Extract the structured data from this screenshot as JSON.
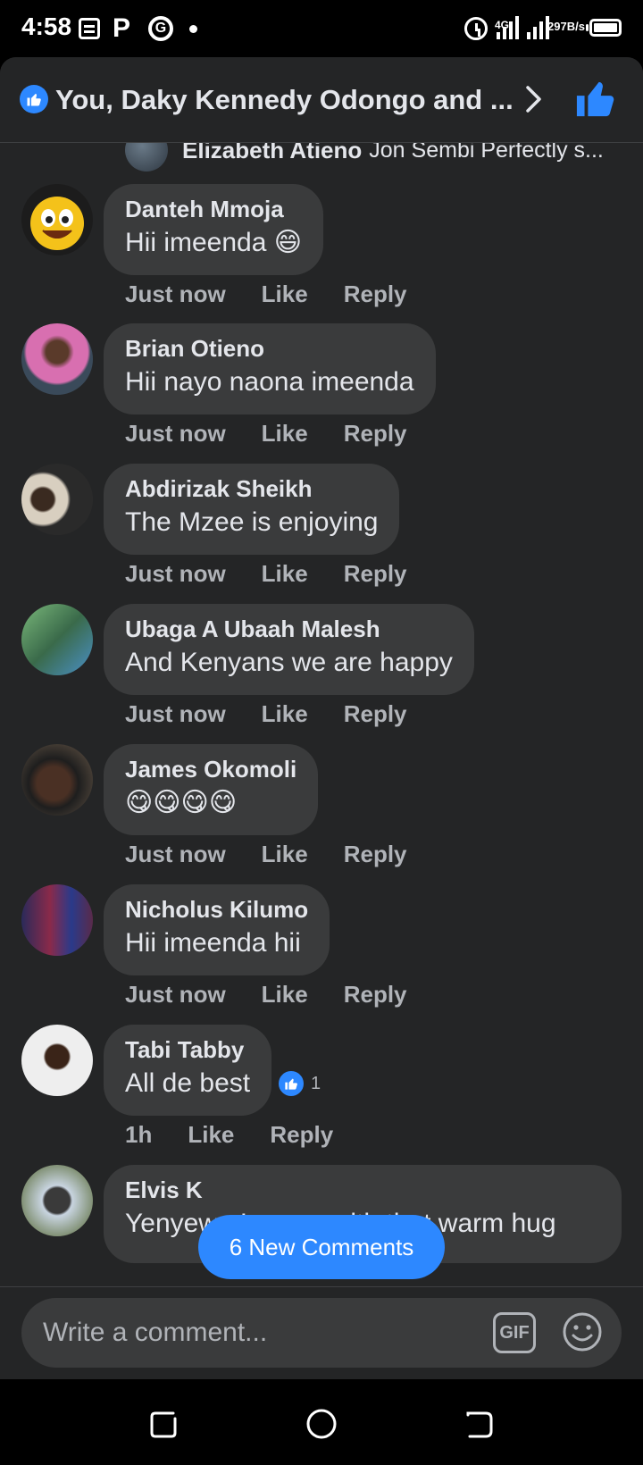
{
  "status_bar": {
    "time": "4:58",
    "network": "4G",
    "speed_value": "297",
    "speed_unit": "B/s"
  },
  "header": {
    "title": "You, Daky Kennedy Odongo and ..."
  },
  "partial_comment": {
    "name": "Elizabeth Atieno",
    "text": "Jon Sembi Perfectly s..."
  },
  "comments": [
    {
      "name": "Danteh Mmoja",
      "text": "Hii imeenda 😄",
      "time": "Just now",
      "like_label": "Like",
      "reply_label": "Reply"
    },
    {
      "name": "Brian Otieno",
      "text": "Hii nayo naona imeenda",
      "time": "Just now",
      "like_label": "Like",
      "reply_label": "Reply"
    },
    {
      "name": "Abdirizak Sheikh",
      "text": "The Mzee is enjoying",
      "time": "Just now",
      "like_label": "Like",
      "reply_label": "Reply"
    },
    {
      "name": "Ubaga A Ubaah Malesh",
      "text": "And Kenyans we are happy",
      "time": "Just now",
      "like_label": "Like",
      "reply_label": "Reply"
    },
    {
      "name": "James Okomoli",
      "text": "😋😋😋😋",
      "time": "Just now",
      "like_label": "Like",
      "reply_label": "Reply"
    },
    {
      "name": "Nicholus Kilumo",
      "text": "Hii imeenda hii",
      "time": "Just now",
      "like_label": "Like",
      "reply_label": "Reply"
    },
    {
      "name": "Tabi Tabby",
      "text": "All de best",
      "time": "1h",
      "like_label": "Like",
      "reply_label": "Reply",
      "reaction_count": "1"
    },
    {
      "name": "Elvis K",
      "text": "Yenyewe Laaree with that warm hug"
    }
  ],
  "new_comments_pill": "6 New Comments",
  "composer": {
    "placeholder": "Write a comment...",
    "gif_label": "GIF"
  },
  "colors": {
    "accent": "#2d88ff",
    "sheet_bg": "#242526",
    "bubble_bg": "#3a3b3c",
    "secondary_text": "#b0b3b8"
  }
}
